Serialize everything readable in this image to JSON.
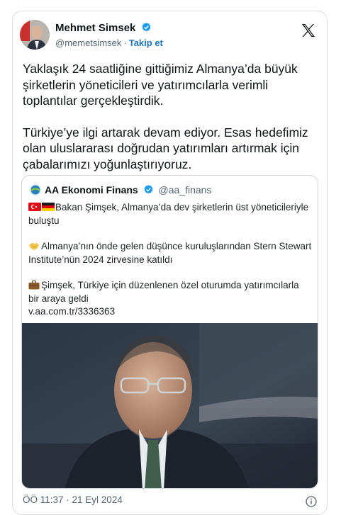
{
  "tweet": {
    "author": {
      "name": "Mehmet Simsek",
      "handle": "@memetsimsek",
      "separator": "·",
      "follow_label": "Takip et"
    },
    "paragraphs": [
      "Yaklaşık 24 saatliğine gittiğimiz Almanya’da büyük\nşirketlerin yöneticileri ve yatırımcılarla verimli\ntoplantılar gerçekleştirdik.",
      "Türkiye’ye ilgi artarak devam ediyor. Esas hedefimiz\nolan uluslararası doğrudan yatırımları artırmak için\nçabalarımızı yoğunlaştırıyoruz."
    ],
    "timestamp": "ÖÖ 11:37 · 21 Eyl 2024"
  },
  "quoted": {
    "author": {
      "name": "AA Ekonomi Finans",
      "handle": "@aa_finans"
    },
    "lines": [
      "Bakan Şimşek, Almanya’da dev şirketlerin üst yöneticileriyle buluştu",
      "Almanya’nın önde gelen düşünce kuruluşlarından Stern Stewart Institute’nün 2024 zirvesine katıldı",
      "Şimşek, Türkiye için düzenlenen özel oturumda yatırımcılarla bir araya geldi"
    ],
    "link": "v.aa.com.tr/3336363"
  },
  "icons": {
    "verified": "verified-badge-icon",
    "x_logo": "x-logo-icon",
    "info": "info-icon",
    "flags": [
      "turkey-flag-icon",
      "germany-flag-icon"
    ],
    "handshake": "handshake-icon",
    "briefcase": "briefcase-icon"
  },
  "colors": {
    "verified": "#1d9bf0",
    "follow": "#1d73b5",
    "secondary_text": "#536471",
    "border": "#d9dde1"
  }
}
